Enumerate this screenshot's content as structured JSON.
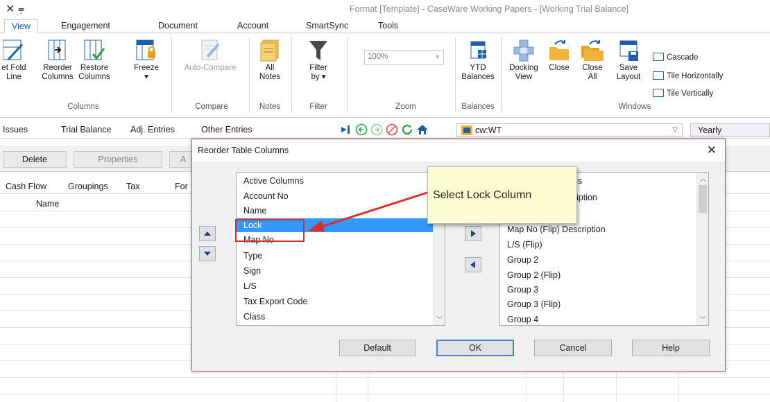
{
  "titlebar": {
    "quick_access": "✕ ⩦",
    "title": "Format [Template] - CaseWare Working Papers - [Working Trial Balance]"
  },
  "tabs": [
    "View",
    "Engagement",
    "Document",
    "Account",
    "SmartSync",
    "Tools"
  ],
  "ribbon": {
    "set_fold_line": "et Fold\nLine",
    "reorder_columns": "Reorder\nColumns",
    "restore_columns": "Restore\nColumns",
    "freeze": "Freeze",
    "freeze_arrow": "▾",
    "group_columns": "Columns",
    "auto_compare": "Auto-Compare",
    "group_compare": "Compare",
    "all_notes": "All\nNotes",
    "group_notes": "Notes",
    "filter_by": "Filter\nby ▾",
    "group_filter": "Filter",
    "zoom_value": "100%",
    "group_zoom": "Zoom",
    "ytd_balances": "YTD\nBalances",
    "group_balances": "Balances",
    "docking_view": "Docking\nView",
    "close": "Close",
    "close_all": "Close\nAll",
    "save_layout": "Save\nLayout",
    "cascade": "Cascade",
    "tile_horizontally": "Tile Horizontally",
    "tile_vertically": "Tile Vertically",
    "group_windows": "Windows"
  },
  "navbar": {
    "issues": "Issues",
    "trial_balance": "Trial Balance",
    "adj_entries": "Adj. Entries",
    "other_entries": "Other Entries",
    "document": "cw:WT",
    "period": "Yearly"
  },
  "toolbar": {
    "delete": "Delete",
    "properties": "Properties",
    "partial": "A"
  },
  "grid": {
    "headers": [
      "Cash Flow",
      "Groupings",
      "Tax",
      "For"
    ],
    "name": "Name"
  },
  "dialog": {
    "title": "Reorder Table Columns",
    "close": "✕",
    "active_columns": [
      "Active Columns",
      "Account No",
      "Name",
      "Lock",
      "Map No",
      "Type",
      "Sign",
      "L/S",
      "Tax Export Code",
      "Class"
    ],
    "selected_index": 3,
    "available_columns": [
      "ns",
      "iption",
      "",
      "Map No (Flip) Description",
      "L/S (Flip)",
      "Group 2",
      "Group 2 (Flip)",
      "Group 3",
      "Group 3 (Flip)",
      "Group 4"
    ],
    "buttons": {
      "default": "Default",
      "ok": "OK",
      "cancel": "Cancel",
      "help": "Help"
    }
  },
  "callout": {
    "text": "Select Lock Column"
  },
  "colors": {
    "accent": "#1f5fa8",
    "selection": "#3399ff",
    "callout_bg": "#fdfbd0",
    "annotation": "#e02b2b"
  }
}
